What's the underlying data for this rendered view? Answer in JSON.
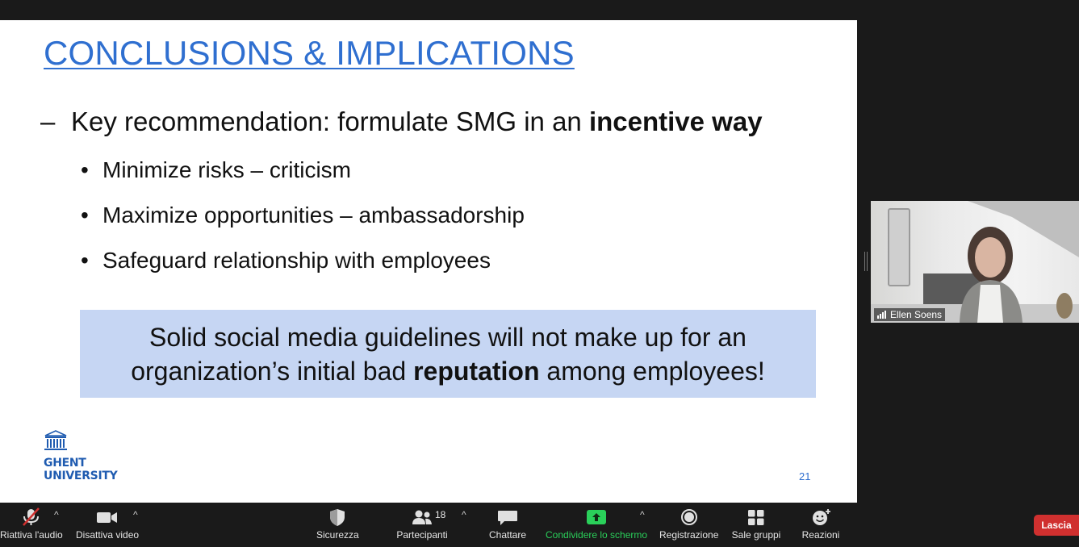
{
  "slide": {
    "title": "CONCLUSIONS & IMPLICATIONS",
    "main_point": {
      "prefix": "Key recommendation: formulate SMG in an ",
      "bold": "incentive way"
    },
    "sub_points": [
      "Minimize risks – criticism",
      "Maximize opportunities – ambassadorship",
      "Safeguard relationship with employees"
    ],
    "callout": {
      "line1": "Solid social media guidelines will not make up for an",
      "line2_prefix": "organization’s initial bad ",
      "line2_bold": "reputation",
      "line2_suffix": " among employees!"
    },
    "logo": {
      "line1": "GHENT",
      "line2": "UNIVERSITY"
    },
    "slide_number": "21",
    "dash": "–",
    "bullet": "•"
  },
  "participant": {
    "name": "Ellen Soens"
  },
  "toolbar": {
    "audio_label": "Riattiva l'audio",
    "video_label": "Disattiva video",
    "security_label": "Sicurezza",
    "participants_label": "Partecipanti",
    "participants_count": "18",
    "chat_label": "Chattare",
    "share_label": "Condividere lo schermo",
    "record_label": "Registrazione",
    "breakout_label": "Sale gruppi",
    "reactions_label": "Reazioni",
    "leave_label": "Lascia",
    "caret": "^"
  },
  "colors": {
    "title": "#2f6fd0",
    "callout_bg": "#c6d6f3",
    "share_green": "#2ad05a",
    "leave_red": "#d0302f",
    "toolbar_bg": "#1a1a1a"
  }
}
